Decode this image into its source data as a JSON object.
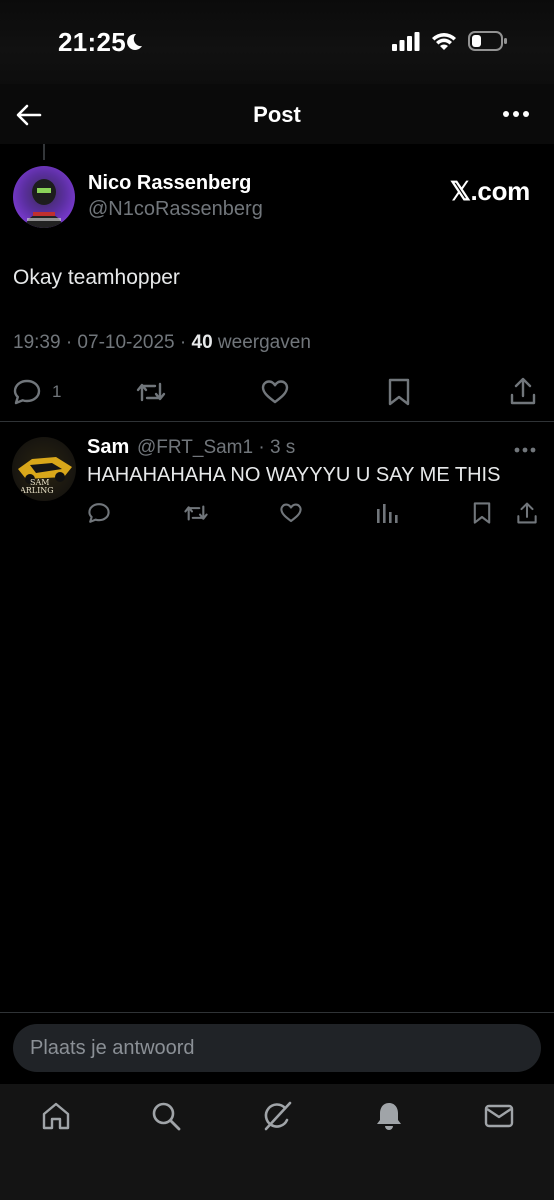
{
  "status_bar": {
    "time": "21:25"
  },
  "header": {
    "title": "Post"
  },
  "post": {
    "author_name": "Nico Rassenberg",
    "author_handle": "@N1coRassenberg",
    "watermark": "𝕏.com",
    "text": "Okay teamhopper",
    "timestamp": "19:39 · 07-10-2025 · ",
    "views_count": "40",
    "views_label": " weergaven",
    "reply_count": "1"
  },
  "reply": {
    "author_name": "Sam",
    "author_handle_time": "@FRT_Sam1 · 3 s",
    "text": "HAHAHAHAHA NO WAYYYU U SAY ME THIS",
    "avatar_text": "SAM\nARLING"
  },
  "composer": {
    "placeholder": "Plaats je antwoord"
  },
  "icons": {
    "back": "arrow-left-icon",
    "more": "more-horizontal-icon",
    "reply": "comment-icon",
    "repost": "repost-icon",
    "like": "heart-icon",
    "bookmark": "bookmark-icon",
    "share": "share-icon",
    "views": "analytics-icon",
    "home": "home-icon",
    "search": "search-icon",
    "grok": "grok-icon",
    "notifications": "bell-icon",
    "messages": "mail-icon"
  },
  "colors": {
    "background": "#000000",
    "text": "#e7e9ea",
    "secondary": "#71767b",
    "divider": "#2f3336"
  }
}
